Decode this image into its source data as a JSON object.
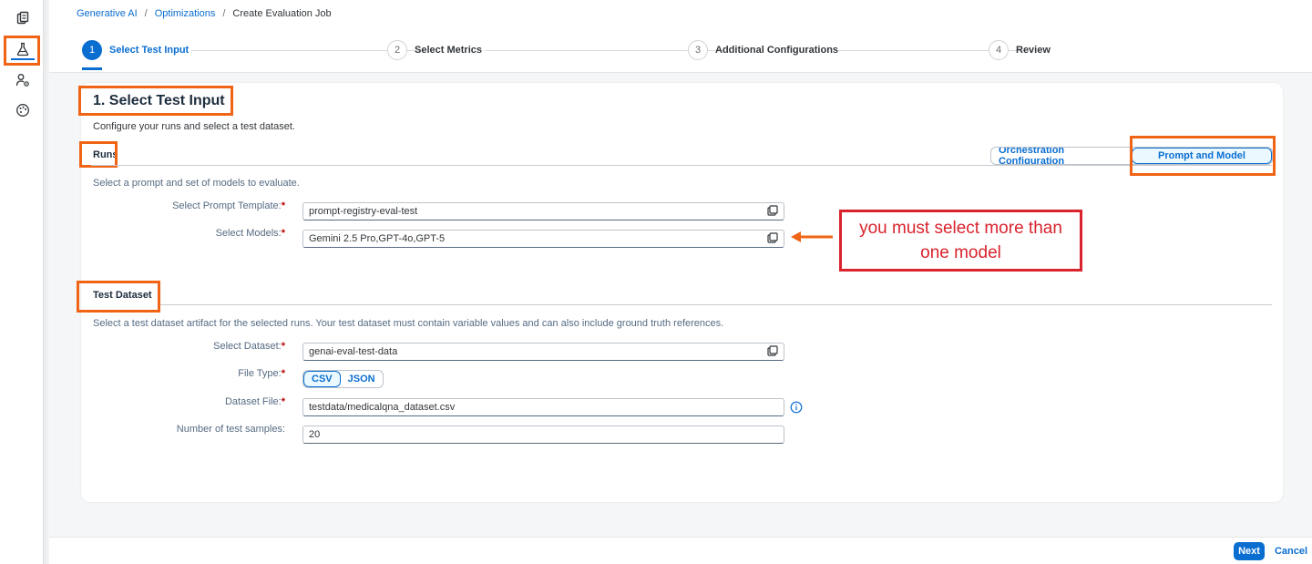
{
  "breadcrumb": {
    "items": [
      "Generative AI",
      "Optimizations"
    ],
    "current": "Create Evaluation Job",
    "separator": "/"
  },
  "wizard": {
    "steps": [
      {
        "number": "1",
        "label": "Select Test Input",
        "active": true
      },
      {
        "number": "2",
        "label": "Select Metrics",
        "active": false
      },
      {
        "number": "3",
        "label": "Additional Configurations",
        "active": false
      },
      {
        "number": "4",
        "label": "Review",
        "active": false
      }
    ]
  },
  "rail": {
    "icons": [
      "documents-icon",
      "flask-icon",
      "user-settings-icon",
      "palette-icon"
    ],
    "active": "flask-icon"
  },
  "main": {
    "title": "1. Select Test Input",
    "description": "Configure your runs and select a test dataset.",
    "runs": {
      "title": "Runs",
      "segments": [
        "Orchestration Configuration",
        "Prompt and Model"
      ],
      "selected_segment": "Prompt and Model",
      "description": "Select a prompt and set of models to evaluate.",
      "prompt_template_label": "Select Prompt Template:",
      "prompt_template_value": "prompt-registry-eval-test",
      "models_label": "Select Models:",
      "models_value": "Gemini 2.5 Pro,GPT-4o,GPT-5"
    },
    "dataset": {
      "title": "Test Dataset",
      "description": "Select a test dataset artifact for the selected runs. Your test dataset must contain variable values and can also include ground truth references.",
      "dataset_label": "Select Dataset:",
      "dataset_value": "genai-eval-test-data",
      "file_type_label": "File Type:",
      "file_types": [
        "CSV",
        "JSON"
      ],
      "selected_file_type": "CSV",
      "dataset_file_label": "Dataset File:",
      "dataset_file_value": "testdata/medicalqna_dataset.csv",
      "samples_label": "Number of test samples:",
      "samples_value": "20",
      "required_marker": "*"
    }
  },
  "annotation": {
    "line1": "you must select more than",
    "line2": "one model",
    "color": "#d9232d",
    "highlight_color": "#f06416"
  },
  "footer": {
    "next_label": "Next",
    "cancel_label": "Cancel"
  },
  "colors": {
    "accent": "#0a6ed1",
    "required": "#bb0000"
  }
}
